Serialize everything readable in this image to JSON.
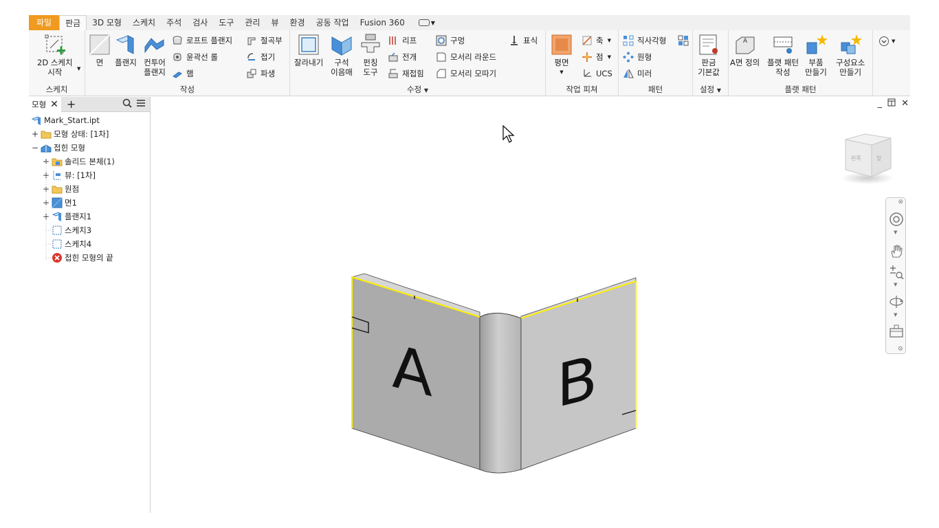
{
  "menu": {
    "file": "파일",
    "tabs": [
      "판금",
      "3D 모형",
      "스케치",
      "주석",
      "검사",
      "도구",
      "관리",
      "뷰",
      "환경",
      "공동 작업",
      "Fusion 360"
    ],
    "active_tab": "판금"
  },
  "ribbon": {
    "sketch_panel": {
      "title": "스케치",
      "start_2d_sketch": "2D 스케치\n시작"
    },
    "create_panel": {
      "title": "작성",
      "face": "면",
      "flange": "플랜지",
      "contour_flange": "컨투어\n플랜지",
      "lofted_flange": "로프트 플랜지",
      "contour_roll": "윤곽선 롤",
      "hem": "햄",
      "bend": "절곡부",
      "fold": "접기",
      "derive": "파생"
    },
    "modify_panel": {
      "title": "수정",
      "cut": "잘라내기",
      "corner_seam": "구석\n이음매",
      "punch_tool": "펀칭\n도구",
      "rip": "리프",
      "unfold": "전개",
      "refold": "재접힘",
      "hole": "구멍",
      "corner_round": "모서리 라운드",
      "corner_chamfer": "모서리 모따기",
      "mark": "표식"
    },
    "work_features_panel": {
      "title": "작업 피쳐",
      "plane": "평면",
      "axis": "축",
      "point": "점",
      "ucs": "UCS"
    },
    "pattern_panel": {
      "title": "패턴",
      "rectangular": "직사각형",
      "circular": "원형",
      "mirror": "미러"
    },
    "setup_panel": {
      "title": "설정",
      "sheet_metal_defaults": "판금\n기본값"
    },
    "flat_pattern_panel": {
      "title": "플랫 패턴",
      "a_side": "A면 정의",
      "create_flat_pattern": "플랫 패턴\n작성",
      "make_part": "부품\n만들기",
      "make_components": "구성요소\n만들기"
    }
  },
  "browser": {
    "tab_label": "모형",
    "root": "Mark_Start.ipt",
    "items": [
      {
        "label": "모형 상태: [1차]"
      },
      {
        "label": "접힌 모형"
      },
      {
        "label": "솔리드 본체(1)"
      },
      {
        "label": "뷰: [1차]"
      },
      {
        "label": "원점"
      },
      {
        "label": "면1"
      },
      {
        "label": "플랜지1"
      },
      {
        "label": "스케치3"
      },
      {
        "label": "스케치4"
      },
      {
        "label": "접힌 모형의 끝"
      }
    ]
  },
  "viewport": {
    "label_a": "A",
    "label_b": "B",
    "viewcube_left": "왼쪽",
    "viewcube_front": "앞",
    "edge_highlight_color": "#ffee00",
    "part_color": "#b9b9b9"
  }
}
